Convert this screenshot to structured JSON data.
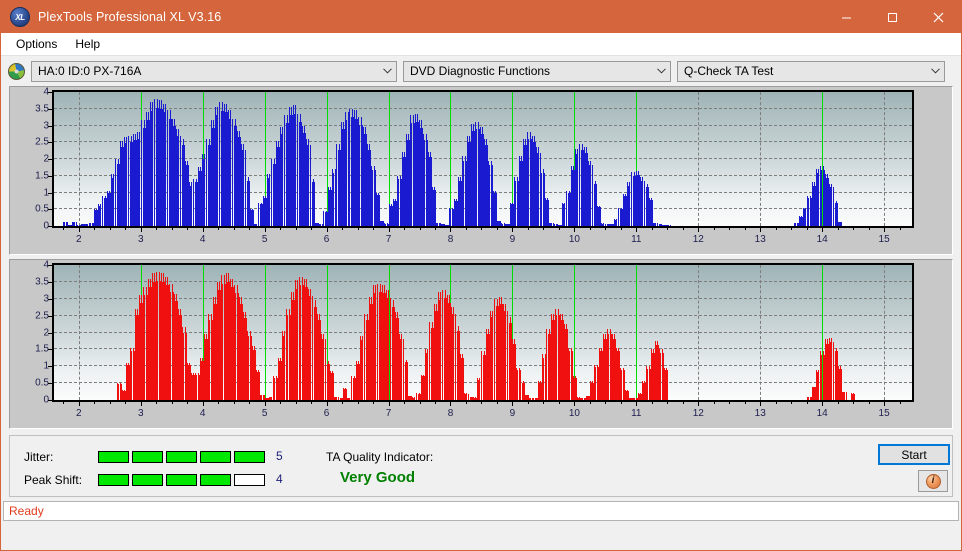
{
  "window": {
    "title": "PlexTools Professional XL V3.16",
    "app_icon": "xl-logo-icon",
    "minimize_label": "Minimize",
    "maximize_label": "Maximize",
    "close_label": "Close"
  },
  "menubar": {
    "items": [
      {
        "label": "Options"
      },
      {
        "label": "Help"
      }
    ]
  },
  "selectors": {
    "device": {
      "value": "HA:0 ID:0  PX-716A",
      "icon": "disc-icon"
    },
    "function": {
      "value": "DVD Diagnostic Functions"
    },
    "test": {
      "value": "Q-Check TA Test"
    }
  },
  "bottom": {
    "jitter_label": "Jitter:",
    "jitter_value": "5",
    "jitter_filled": 5,
    "jitter_total": 5,
    "peak_shift_label": "Peak Shift:",
    "peak_shift_value": "4",
    "peak_shift_filled": 4,
    "peak_shift_total": 5,
    "ta_quality_label": "TA Quality Indicator:",
    "ta_quality_value": "Very Good",
    "ta_quality_color": "#008000",
    "start_label": "Start",
    "info_label": "i"
  },
  "statusbar": {
    "text": "Ready"
  },
  "colors": {
    "titlebar": "#d4653c",
    "chart1_bar": "#1a1ad0",
    "chart2_bar": "#f01010",
    "marker_green": "#00dd00",
    "meter_green": "#00e800",
    "status_red": "#e03c1c"
  },
  "chart_data": [
    {
      "id": "chart1",
      "type": "bar",
      "title": "",
      "xlabel": "",
      "ylabel": "",
      "bar_color": "#1a1ad0",
      "xlim": [
        1.6,
        15.45
      ],
      "ylim": [
        0,
        4
      ],
      "yticks": [
        0,
        0.5,
        1,
        1.5,
        2,
        2.5,
        3,
        3.5,
        4
      ],
      "ytick_labels": [
        "0",
        "0.5",
        "1",
        "1.5",
        "2",
        "2.5",
        "3",
        "3.5",
        "4"
      ],
      "xticks": [
        2,
        3,
        4,
        5,
        6,
        7,
        8,
        9,
        10,
        11,
        12,
        13,
        14,
        15
      ],
      "xtick_labels": [
        "2",
        "3",
        "4",
        "5",
        "6",
        "7",
        "8",
        "9",
        "10",
        "11",
        "12",
        "13",
        "14",
        "15"
      ],
      "grid": true,
      "markers": [
        3,
        4,
        5,
        6,
        7,
        8,
        9,
        10,
        11,
        14
      ],
      "x": [
        1.75,
        1.82,
        1.89,
        1.96,
        2.03,
        2.1,
        2.17,
        2.24,
        2.31,
        2.38,
        2.45,
        2.52,
        2.59,
        2.66,
        2.73,
        2.8,
        2.87,
        2.94,
        3.01,
        3.08,
        3.15,
        3.22,
        3.29,
        3.36,
        3.43,
        3.5,
        3.57,
        3.64,
        3.71,
        3.78,
        3.85,
        3.92,
        3.99,
        4.06,
        4.13,
        4.2,
        4.27,
        4.34,
        4.41,
        4.48,
        4.55,
        4.62,
        4.69,
        4.76,
        4.83,
        4.9,
        4.97,
        5.04,
        5.11,
        5.18,
        5.25,
        5.32,
        5.39,
        5.46,
        5.53,
        5.6,
        5.67,
        5.74,
        5.81,
        5.88,
        5.95,
        6.02,
        6.09,
        6.16,
        6.23,
        6.3,
        6.37,
        6.44,
        6.51,
        6.58,
        6.65,
        6.72,
        6.79,
        6.86,
        6.93,
        7.0,
        7.07,
        7.14,
        7.21,
        7.28,
        7.35,
        7.42,
        7.49,
        7.56,
        7.63,
        7.7,
        7.77,
        7.84,
        7.91,
        7.98,
        8.05,
        8.12,
        8.19,
        8.26,
        8.33,
        8.4,
        8.47,
        8.54,
        8.61,
        8.68,
        8.75,
        8.82,
        8.89,
        8.96,
        9.03,
        9.1,
        9.17,
        9.24,
        9.31,
        9.38,
        9.45,
        9.52,
        9.59,
        9.66,
        9.73,
        9.8,
        9.87,
        9.94,
        10.01,
        10.08,
        10.15,
        10.22,
        10.29,
        10.36,
        10.43,
        10.5,
        10.57,
        10.64,
        10.71,
        10.78,
        10.85,
        10.92,
        10.99,
        11.06,
        11.13,
        11.2,
        11.27,
        11.34,
        11.41,
        11.48,
        13.55,
        13.62,
        13.69,
        13.76,
        13.83,
        13.9,
        13.97,
        14.04,
        14.11,
        14.18,
        14.25
      ],
      "values": [
        0.12,
        0.02,
        0.12,
        0.02,
        0.06,
        0.06,
        0.1,
        0.5,
        0.65,
        0.9,
        1.05,
        1.55,
        2.0,
        2.55,
        2.65,
        2.7,
        2.75,
        2.8,
        3.15,
        3.4,
        3.7,
        3.8,
        3.75,
        3.65,
        3.45,
        3.2,
        2.9,
        2.6,
        1.95,
        1.3,
        1.4,
        1.75,
        2.15,
        2.6,
        3.15,
        3.55,
        3.7,
        3.65,
        3.45,
        3.2,
        2.85,
        2.45,
        1.45,
        0.5,
        0.05,
        0.7,
        0.9,
        1.55,
        2.0,
        2.55,
        2.95,
        3.3,
        3.55,
        3.6,
        3.35,
        3.0,
        2.6,
        1.4,
        0.1,
        0.06,
        0.45,
        1.15,
        1.7,
        2.45,
        3.1,
        3.4,
        3.5,
        3.45,
        3.25,
        2.95,
        2.45,
        1.8,
        1.0,
        0.15,
        0.08,
        0.65,
        0.8,
        1.5,
        2.2,
        2.75,
        3.3,
        3.35,
        3.15,
        2.75,
        2.2,
        1.15,
        0.1,
        0.06,
        0.04,
        0.55,
        0.8,
        1.45,
        2.1,
        2.7,
        3.05,
        3.1,
        2.95,
        2.6,
        1.95,
        1.05,
        0.15,
        0.08,
        0.06,
        0.7,
        1.45,
        2.1,
        2.6,
        2.8,
        2.7,
        2.35,
        1.7,
        0.85,
        0.1,
        0.06,
        0.04,
        0.7,
        1.05,
        1.8,
        2.3,
        2.45,
        2.35,
        1.95,
        1.35,
        0.6,
        0.08,
        0.05,
        0.06,
        0.2,
        0.55,
        0.95,
        1.3,
        1.6,
        1.65,
        1.45,
        1.25,
        0.85,
        0.1,
        0.05,
        0.04,
        0.03,
        0.1,
        0.3,
        0.55,
        0.9,
        1.3,
        1.7,
        1.8,
        1.55,
        1.25,
        0.75,
        0.12
      ]
    },
    {
      "id": "chart2",
      "type": "bar",
      "title": "",
      "xlabel": "",
      "ylabel": "",
      "bar_color": "#f01010",
      "xlim": [
        1.6,
        15.45
      ],
      "ylim": [
        0,
        4
      ],
      "yticks": [
        0,
        0.5,
        1,
        1.5,
        2,
        2.5,
        3,
        3.5,
        4
      ],
      "ytick_labels": [
        "0",
        "0.5",
        "1",
        "1.5",
        "2",
        "2.5",
        "3",
        "3.5",
        "4"
      ],
      "xticks": [
        2,
        3,
        4,
        5,
        6,
        7,
        8,
        9,
        10,
        11,
        12,
        13,
        14,
        15
      ],
      "xtick_labels": [
        "2",
        "3",
        "4",
        "5",
        "6",
        "7",
        "8",
        "9",
        "10",
        "11",
        "12",
        "13",
        "14",
        "15"
      ],
      "grid": true,
      "markers": [
        3,
        4,
        5,
        6,
        7,
        8,
        9,
        10,
        11,
        14
      ],
      "x": [
        2.62,
        2.69,
        2.76,
        2.83,
        2.9,
        2.97,
        3.04,
        3.11,
        3.18,
        3.25,
        3.32,
        3.39,
        3.46,
        3.53,
        3.6,
        3.67,
        3.74,
        3.81,
        3.88,
        3.95,
        4.02,
        4.09,
        4.16,
        4.23,
        4.3,
        4.37,
        4.44,
        4.51,
        4.58,
        4.65,
        4.72,
        4.79,
        4.86,
        4.93,
        5.0,
        5.07,
        5.14,
        5.21,
        5.28,
        5.35,
        5.42,
        5.49,
        5.56,
        5.63,
        5.7,
        5.77,
        5.84,
        5.91,
        5.98,
        6.05,
        6.12,
        6.19,
        6.26,
        6.33,
        6.4,
        6.47,
        6.54,
        6.61,
        6.68,
        6.75,
        6.82,
        6.89,
        6.96,
        7.03,
        7.1,
        7.17,
        7.24,
        7.31,
        7.38,
        7.45,
        7.52,
        7.59,
        7.66,
        7.73,
        7.8,
        7.87,
        7.94,
        8.01,
        8.08,
        8.15,
        8.22,
        8.29,
        8.36,
        8.43,
        8.5,
        8.57,
        8.64,
        8.71,
        8.78,
        8.85,
        8.92,
        8.99,
        9.06,
        9.13,
        9.2,
        9.27,
        9.34,
        9.41,
        9.48,
        9.55,
        9.62,
        9.69,
        9.76,
        9.83,
        9.9,
        9.97,
        10.04,
        10.11,
        10.18,
        10.25,
        10.32,
        10.39,
        10.46,
        10.53,
        10.6,
        10.67,
        10.74,
        10.81,
        10.88,
        10.95,
        11.02,
        11.09,
        11.16,
        11.23,
        11.3,
        11.37,
        11.44,
        13.76,
        13.83,
        13.9,
        13.97,
        14.04,
        14.11,
        14.18,
        14.25,
        14.32,
        14.46
      ],
      "values": [
        0.5,
        0.3,
        1.1,
        1.55,
        2.7,
        3.1,
        3.35,
        3.6,
        3.75,
        3.8,
        3.75,
        3.65,
        3.45,
        3.15,
        2.7,
        2.15,
        1.1,
        0.8,
        0.8,
        1.25,
        1.95,
        2.55,
        3.05,
        3.5,
        3.7,
        3.75,
        3.6,
        3.4,
        3.05,
        2.6,
        2.05,
        1.6,
        0.9,
        0.15,
        0.05,
        0.1,
        0.7,
        1.25,
        2.05,
        2.7,
        3.2,
        3.55,
        3.65,
        3.6,
        3.3,
        2.95,
        2.55,
        1.95,
        1.15,
        0.85,
        0.1,
        0.05,
        0.35,
        0.05,
        0.7,
        1.15,
        1.9,
        2.55,
        3.05,
        3.4,
        3.45,
        3.4,
        3.25,
        2.95,
        2.6,
        1.95,
        1.2,
        0.12,
        0.08,
        0.2,
        0.75,
        1.5,
        2.3,
        2.85,
        3.2,
        3.25,
        3.1,
        2.75,
        2.2,
        1.35,
        0.2,
        0.1,
        0.08,
        0.65,
        1.45,
        2.1,
        2.65,
        3.0,
        3.05,
        2.85,
        2.45,
        1.8,
        0.95,
        0.55,
        0.15,
        0.06,
        0.05,
        0.55,
        1.35,
        2.1,
        2.55,
        2.7,
        2.55,
        2.25,
        1.55,
        0.7,
        0.08,
        0.05,
        0.12,
        0.55,
        1.05,
        1.55,
        1.95,
        2.1,
        1.95,
        1.55,
        0.95,
        0.3,
        0.06,
        0.05,
        0.2,
        0.55,
        1.0,
        1.5,
        1.75,
        1.5,
        0.95,
        0.1,
        0.4,
        0.9,
        1.45,
        1.8,
        1.85,
        1.55,
        1.0,
        0.25,
        0.2
      ]
    }
  ]
}
